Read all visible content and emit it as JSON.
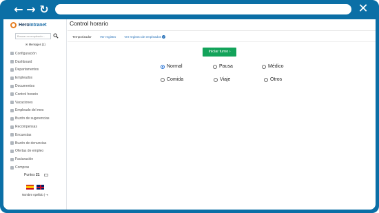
{
  "sidebar": {
    "logo": {
      "text_a": "Hero",
      "text_b": "Intranet"
    },
    "search_placeholder": "Buscar en empleado...",
    "messages_label": "Mensajes (1)",
    "items": [
      {
        "label": "Configuración",
        "icon": "gear-icon"
      },
      {
        "label": "Dashboard",
        "icon": "dashboard-icon"
      },
      {
        "label": "Departamentos",
        "icon": "building-icon"
      },
      {
        "label": "Empleados",
        "icon": "user-icon"
      },
      {
        "label": "Documentos",
        "icon": "document-icon"
      },
      {
        "label": "Control horario",
        "icon": "clock-icon"
      },
      {
        "label": "Vacaciones",
        "icon": "plane-icon"
      },
      {
        "label": "Empleado del mes",
        "icon": "trophy-icon"
      },
      {
        "label": "Buzón de sugerencias",
        "icon": "inbox-icon"
      },
      {
        "label": "Recompensas",
        "icon": "gift-icon"
      },
      {
        "label": "Encuestas",
        "icon": "poll-icon"
      },
      {
        "label": "Buzón de denuncias",
        "icon": "alert-icon"
      },
      {
        "label": "Ofertas de empleo",
        "icon": "briefcase-icon"
      },
      {
        "label": "Facturación",
        "icon": "invoice-icon"
      },
      {
        "label": "Compras",
        "icon": "cart-icon"
      }
    ],
    "points_label": "Puntos",
    "points_value": "21",
    "user_line": "Nombre Apellido  |  ⇥"
  },
  "main": {
    "title": "Control horario",
    "tabs": [
      {
        "label": "Temporizador",
        "active": true
      },
      {
        "label": "Ver registro",
        "active": false
      },
      {
        "label": "Ver registro de empleados",
        "active": false
      }
    ],
    "start_button": "Iniciar turno ›",
    "options": [
      {
        "label": "Normal",
        "checked": true
      },
      {
        "label": "Pausa",
        "checked": false
      },
      {
        "label": "Médico",
        "checked": false
      },
      {
        "label": "Comida",
        "checked": false
      },
      {
        "label": "Viaje",
        "checked": false
      },
      {
        "label": "Otros",
        "checked": false
      }
    ]
  },
  "colors": {
    "frame": "#0b6fa6",
    "start_button": "#13a35a",
    "link": "#2a73b9",
    "radio_checked": "#1f6ed4"
  }
}
